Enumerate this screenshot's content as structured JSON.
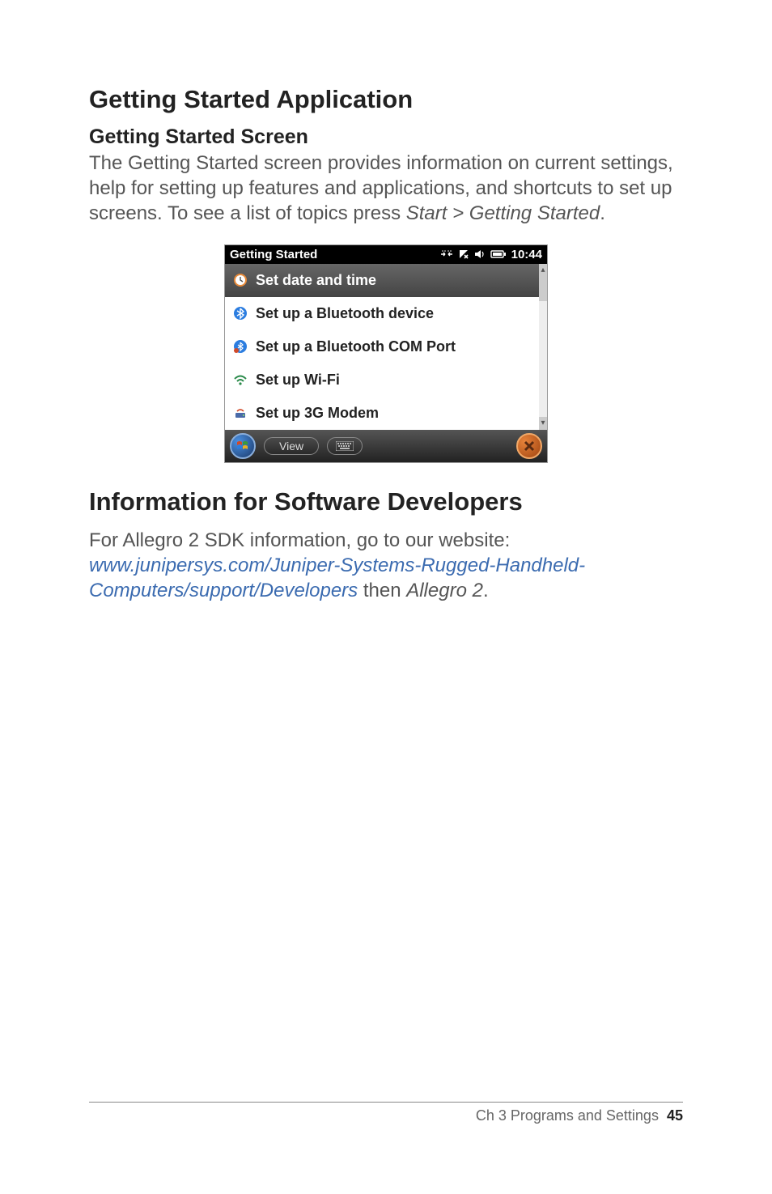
{
  "headings": {
    "main1": "Getting Started Application",
    "sub1": "Getting Started Screen",
    "main2": "Information for Software Developers"
  },
  "paragraphs": {
    "p1_a": "The Getting Started screen provides information on current settings, help for setting up features and applications, and shortcuts to set up screens. To see a list of topics press ",
    "p1_b": "Start > Getting Started",
    "p1_c": ".",
    "p2_a": "For Allegro 2 SDK information, go to our website: ",
    "p2_link": "www.junipersys.com/Juniper-Systems-Rugged-Handheld-Computers/support/Developers",
    "p2_b": " then ",
    "p2_italic": "Allegro 2",
    "p2_c": "."
  },
  "screenshot": {
    "title": "Getting Started",
    "time": "10:44",
    "rows": [
      "Set date and time",
      "Set up a Bluetooth device",
      "Set up a Bluetooth COM Port",
      "Set up Wi-Fi",
      "Set up 3G Modem"
    ],
    "view_button": "View"
  },
  "footer": {
    "chapter": "Ch 3   Programs and Settings",
    "page": "45"
  }
}
